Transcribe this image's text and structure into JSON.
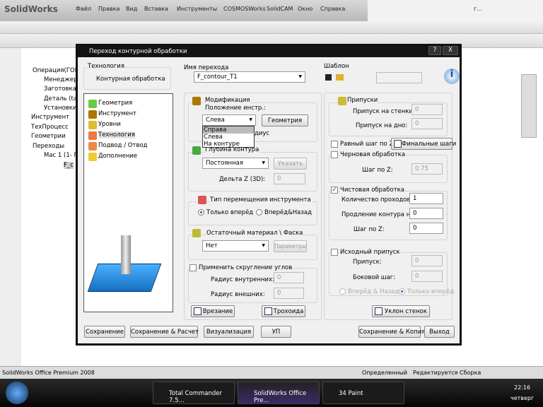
{
  "app": {
    "brand": "SolidWorks",
    "menu": [
      "Файл",
      "Правка",
      "Вид",
      "Вставка",
      "Инструменты",
      "COSMOSWorks",
      "SolidCAM",
      "Окно",
      "Справка"
    ],
    "title_trunc": "г..."
  },
  "tree": {
    "items": [
      "Операция(ГОРИ",
      "Менеджер",
      "Заготовка",
      "Деталь (tar",
      "Установки",
      "Инструмент",
      "ТехПроцесс",
      "Геометрии",
      "Переходы",
      "Мас 1 (1- П",
      "F_c"
    ]
  },
  "dialog": {
    "title": "Переход контурной обработки",
    "help": "?",
    "close": "X",
    "technology": {
      "label": "Технология",
      "value": "Контурная обработка"
    },
    "op_name": {
      "label": "Имя перехода",
      "value": "F_contour_T1"
    },
    "template": {
      "label": "Шаблон",
      "value": ""
    },
    "nav": [
      "Геометрия",
      "Инструмент",
      "Уровни",
      "Технология",
      "Подвод / Отвод",
      "Дополнение"
    ],
    "nav_selected": "Технология",
    "modification": {
      "label": "Модификация",
      "position_label": "Положение инстр.:",
      "position_value": "Слева",
      "options": [
        "Справа",
        "Слева",
        "На контуре"
      ],
      "highlighted": "Справа",
      "geometry_btn": "Геометрия",
      "hidden_text": "диус"
    },
    "depth": {
      "label": "Глубина контура",
      "value": "Постоянная",
      "specify_btn": "Указать",
      "delta_label": "Дельта Z (3D):",
      "delta_value": "0"
    },
    "move_type": {
      "label": "Тип перемещения инструмента",
      "opt1": "Только вперёд",
      "opt2": "Вперёд&Назад",
      "selected": "Только вперёд"
    },
    "residual": {
      "label": "Остаточный материал \\ Фаска",
      "value": "Нет",
      "params_btn": "Параметры"
    },
    "rounding": {
      "label": "Применить скругление углов",
      "checked": false,
      "inner_label": "Радиус внутренних:",
      "inner_value": "0",
      "outer_label": "Радиус внешних:",
      "outer_value": "0"
    },
    "plunge_btn": "Врезание",
    "trochoid_btn": "Трохоида",
    "allowances": {
      "label": "Припуски",
      "wall_label": "Припуск на стенки:",
      "wall_value": "0",
      "floor_label": "Припуск на дно:",
      "floor_value": "0"
    },
    "equal_step": {
      "label": "Равный шаг по Z",
      "checked": false
    },
    "final_steps_btn": "Финальные шаги",
    "rough": {
      "label": "Черновая обработка",
      "checked": false,
      "step_label": "Шаг по Z:",
      "step_value": "0.75"
    },
    "finish": {
      "label": "Чистовая обработка",
      "checked": true,
      "passes_label": "Количество проходов:",
      "passes_value": "1",
      "extend_label": "Продление контура на:",
      "extend_value": "0",
      "step_label": "Шаг по Z:",
      "step_value": "0"
    },
    "initial": {
      "label": "Исходный припуск",
      "checked": false,
      "allow_label": "Припуск:",
      "allow_value": "0",
      "side_label": "Боковой шаг:",
      "side_value": "0",
      "opt1": "Вперёд & Назад",
      "opt2": "Только вперёд",
      "selected": "Только вперёд"
    },
    "draft_btn": "Уклон стенок",
    "buttons": [
      "Сохранение",
      "Сохранение & Расчет",
      "Визуализация",
      "УП",
      "Сохранение & Копия",
      "Выход"
    ]
  },
  "status": {
    "left": "SolidWorks Office Premium 2008",
    "s1": "Определенный",
    "s2": "Редактируется Сборка"
  },
  "taskbar": {
    "tasks": [
      "Total Commander 7.5...",
      "SolidWorks Office Pre...",
      "34 Paint"
    ],
    "time": "22:16",
    "day": "четверг"
  }
}
